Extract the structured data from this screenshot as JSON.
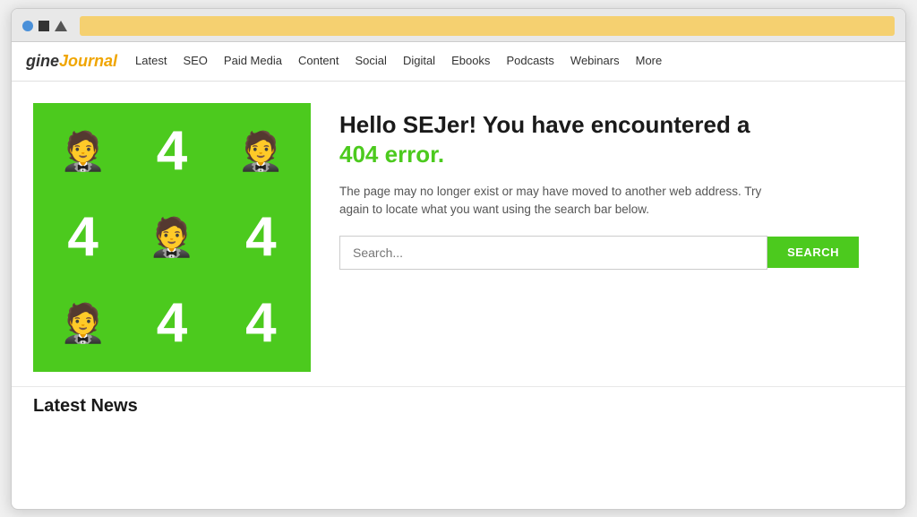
{
  "browser": {
    "address_bar_color": "#f5d070"
  },
  "nav": {
    "logo_engine": "gine",
    "logo_journal": "Journal",
    "items": [
      {
        "label": "Latest"
      },
      {
        "label": "SEO"
      },
      {
        "label": "Paid Media"
      },
      {
        "label": "Content"
      },
      {
        "label": "Social"
      },
      {
        "label": "Digital"
      },
      {
        "label": "Ebooks"
      },
      {
        "label": "Podcasts"
      },
      {
        "label": "Webinars"
      },
      {
        "label": "More"
      }
    ]
  },
  "error_page": {
    "headline": "Hello SEJer! You have encountered a",
    "error_code": "404 error.",
    "description": "The page may no longer exist or may have moved to another web address. Try again to locate what you want using the search bar below.",
    "search_placeholder": "Search...",
    "search_button_label": "SEARCH"
  },
  "latest_news": {
    "title": "Latest News"
  },
  "grid_cells": [
    {
      "type": "face"
    },
    {
      "type": "four"
    },
    {
      "type": "four"
    },
    {
      "type": "face"
    },
    {
      "type": "four"
    },
    {
      "type": "four"
    },
    {
      "type": "face"
    },
    {
      "type": "four"
    },
    {
      "type": "four"
    },
    {
      "type": "face"
    },
    {
      "type": "face"
    }
  ]
}
